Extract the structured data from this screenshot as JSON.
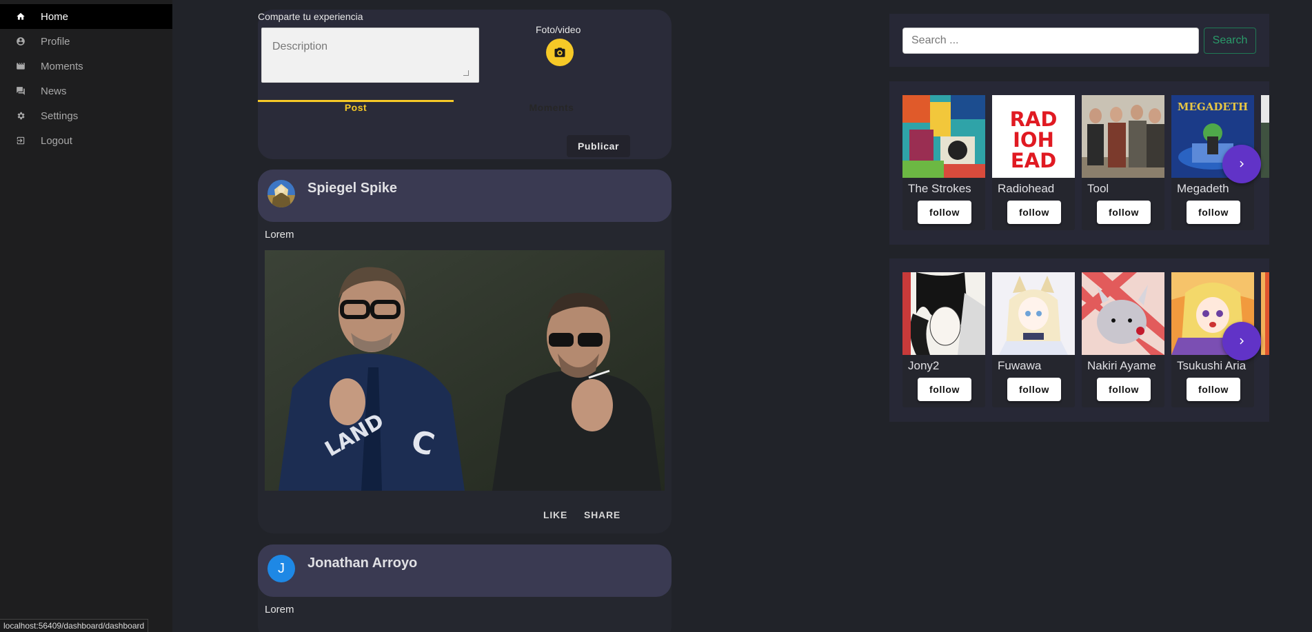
{
  "sidebar": {
    "items": [
      {
        "label": "Home",
        "icon": "home-icon"
      },
      {
        "label": "Profile",
        "icon": "account-circle-icon"
      },
      {
        "label": "Moments",
        "icon": "movie-icon"
      },
      {
        "label": "News",
        "icon": "forum-icon"
      },
      {
        "label": "Settings",
        "icon": "gear-icon"
      },
      {
        "label": "Logout",
        "icon": "logout-icon"
      }
    ]
  },
  "composer": {
    "title": "Comparte tu experiencia",
    "description_placeholder": "Description",
    "media_label": "Foto/video",
    "tabs": [
      {
        "label": "Post"
      },
      {
        "label": "Moments"
      }
    ],
    "publish_label": "Publicar",
    "accent_color": "#f6c927"
  },
  "posts": [
    {
      "author": "Spiegel Spike",
      "text": "Lorem",
      "like_label": "LIKE",
      "share_label": "SHARE"
    },
    {
      "author": "Jonathan Arroyo",
      "avatar_letter": "J",
      "text": "Lorem"
    }
  ],
  "search": {
    "placeholder": "Search ...",
    "button_label": "Search"
  },
  "artists": [
    {
      "name": "The Strokes",
      "follow_label": "follow"
    },
    {
      "name": "Radiohead",
      "follow_label": "follow",
      "logo_lines": [
        "RAD",
        "IOH",
        "EAD"
      ]
    },
    {
      "name": "Tool",
      "follow_label": "follow"
    },
    {
      "name": "Megadeth",
      "follow_label": "follow",
      "logo_text": "MEGADETH"
    }
  ],
  "vtubers": [
    {
      "name": "Jony2",
      "follow_label": "follow"
    },
    {
      "name": "Fuwawa",
      "follow_label": "follow"
    },
    {
      "name": "Nakiri Ayame",
      "follow_label": "follow"
    },
    {
      "name": "Tsukushi Aria",
      "follow_label": "follow"
    }
  ],
  "status_bar": {
    "url": "localhost:56409/dashboard/dashboard"
  },
  "colors": {
    "background": "#212329",
    "sidebar": "#1e1e1f",
    "panel": "#272836",
    "carousel_next": "#6133c7",
    "search_green": "#2a9b6a"
  }
}
